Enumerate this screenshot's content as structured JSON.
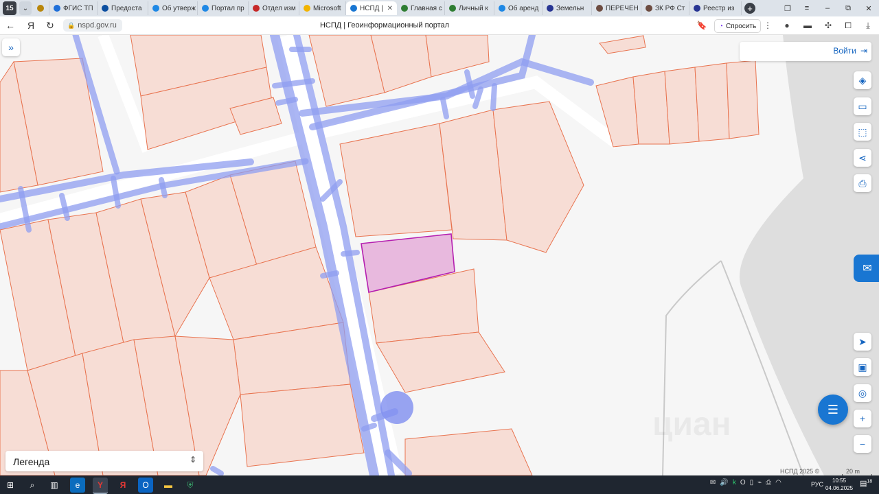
{
  "browser": {
    "tab_counter": "15",
    "tabs": [
      {
        "label": "",
        "color": "#b8860b"
      },
      {
        "label": "ФГИС ТП",
        "color": "#1e6fd9"
      },
      {
        "label": "Предоста",
        "color": "#0a4ea0"
      },
      {
        "label": "Об утверж",
        "color": "#1e88e5"
      },
      {
        "label": "Портал пр",
        "color": "#1e88e5"
      },
      {
        "label": "Отдел изм",
        "color": "#c62828"
      },
      {
        "label": "Microsoft",
        "color": "#f2b400"
      },
      {
        "label": "НСПД |",
        "color": "#1976d2",
        "active": true
      },
      {
        "label": "Главная с",
        "color": "#2e7d32"
      },
      {
        "label": "Личный к",
        "color": "#2e7d32"
      },
      {
        "label": "Об аренд",
        "color": "#1e88e5"
      },
      {
        "label": "Земельн",
        "color": "#283593"
      },
      {
        "label": "ПЕРЕЧЕН",
        "color": "#6d4c41"
      },
      {
        "label": "ЗК РФ Ст",
        "color": "#6d4c41"
      },
      {
        "label": "Реестр из",
        "color": "#283593"
      }
    ],
    "url": "nspd.gov.ru",
    "page_title": "НСПД | Геоинформационный портал",
    "ask_label": "Спросить"
  },
  "map": {
    "login_label": "Войти",
    "legend_label": "Легенда",
    "attribution": "НСПД 2025 ©",
    "scale": "20 m",
    "watermark": "циан",
    "colors": {
      "parcel_fill": "#f7ddd5",
      "parcel_stroke": "#e8734f",
      "selected_fill": "#e8b9de",
      "selected_stroke": "#b51fb0",
      "utility_line": "#8f9ef0",
      "road": "#ffffff",
      "background": "#f6f6f6",
      "water": "#dedede"
    },
    "controls": [
      "layers-icon",
      "ruler-icon",
      "select-area-icon",
      "share-icon",
      "print-icon",
      "navigate-icon",
      "minimap-icon",
      "geolocation-icon",
      "zoom-in-icon",
      "zoom-out-icon"
    ]
  },
  "taskbar": {
    "language": "РУС",
    "time": "10:55",
    "date": "04.06.2025",
    "notifications": "18"
  }
}
